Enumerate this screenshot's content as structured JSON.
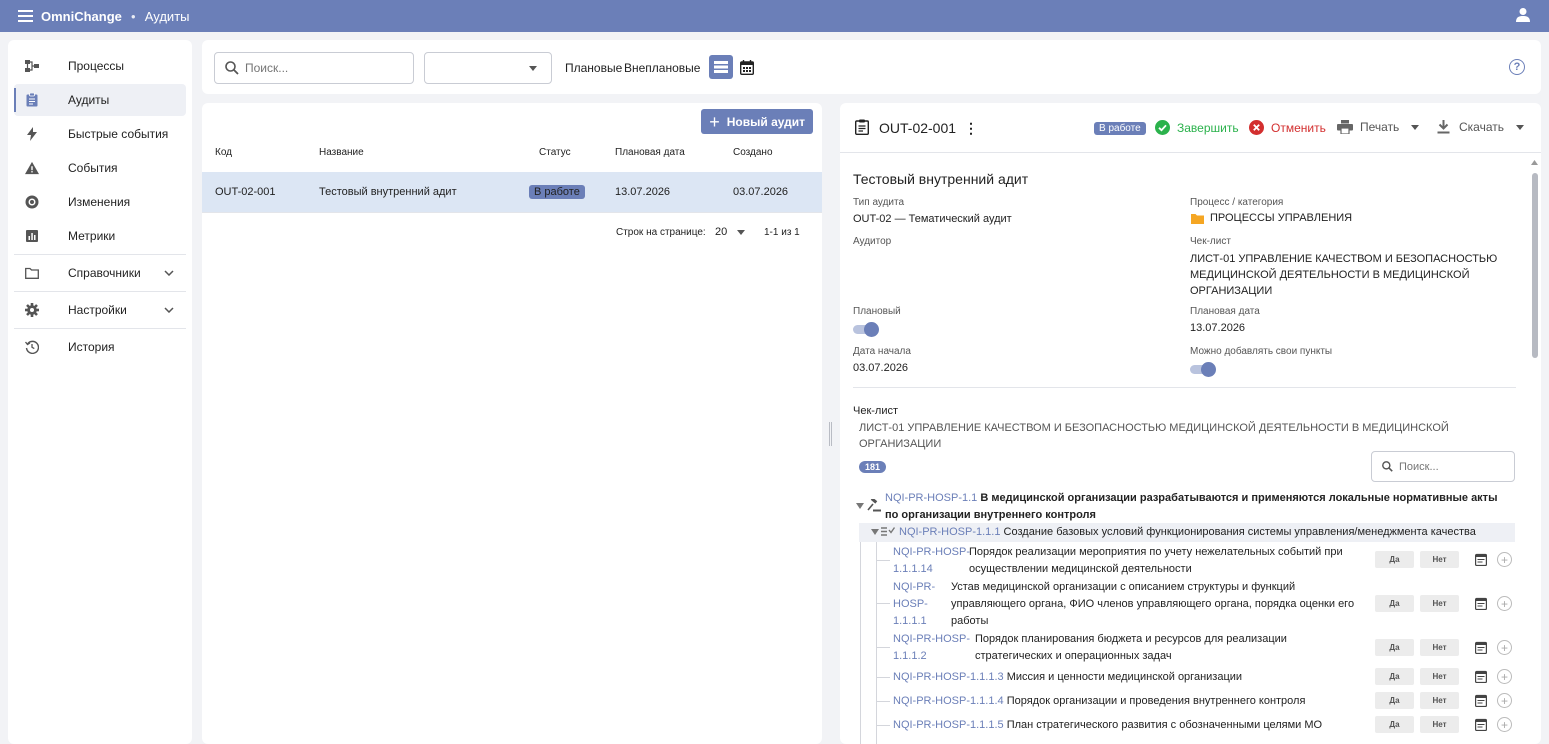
{
  "topbar": {
    "brand": "OmniChange",
    "section": "Аудиты"
  },
  "sidebar": {
    "items": [
      {
        "label": "Процессы",
        "icon": "process-icon"
      },
      {
        "label": "Аудиты",
        "icon": "clipboard-icon",
        "active": true
      },
      {
        "label": "Быстрые события",
        "icon": "lightning-icon"
      },
      {
        "label": "События",
        "icon": "warning-icon"
      },
      {
        "label": "Изменения",
        "icon": "change-icon"
      },
      {
        "label": "Метрики",
        "icon": "metrics-icon"
      },
      {
        "label": "Справочники",
        "icon": "folder-icon",
        "expandable": true
      },
      {
        "label": "Настройки",
        "icon": "gear-icon",
        "expandable": true
      },
      {
        "label": "История",
        "icon": "history-icon"
      }
    ]
  },
  "toolbar": {
    "search_placeholder": "Поиск...",
    "select_value": "",
    "planned_label": "Плановые",
    "unplanned_label": "Внеплановые"
  },
  "list": {
    "new_button": "Новый аудит",
    "columns": [
      "Код",
      "Название",
      "Статус",
      "Плановая дата",
      "Создано"
    ],
    "rows": [
      {
        "code": "OUT-02-001",
        "name": "Тестовый внутренний адит",
        "status": "В работе",
        "planned": "13.07.2026",
        "created": "03.07.2026"
      }
    ],
    "rows_per_page_label": "Строк на странице:",
    "rows_per_page": "20",
    "range": "1-1 из 1"
  },
  "detail": {
    "code": "OUT-02-001",
    "status": "В работе",
    "finish_label": "Завершить",
    "cancel_label": "Отменить",
    "print_label": "Печать",
    "download_label": "Скачать",
    "title": "Тестовый внутренний адит",
    "audit_type_label": "Тип аудита",
    "audit_type": "OUT-02 — Тематический аудит",
    "process_label": "Процесс / категория",
    "process": "ПРОЦЕССЫ УПРАВЛЕНИЯ",
    "auditor_label": "Аудитор",
    "checklist_label": "Чек-лист",
    "checklist_line1": "ЛИСТ-01 УПРАВЛЕНИЕ КАЧЕСТВОМ И БЕЗОПАСНОСТЬЮ",
    "checklist_line2": "МЕДИЦИНСКОЙ ДЕЯТЕЛЬНОСТИ В МЕДИЦИНСКОЙ",
    "checklist_line3": "ОРГАНИЗАЦИИ",
    "planned_label": "Плановый",
    "planned_on": true,
    "planned_date_label": "Плановая дата",
    "planned_date": "13.07.2026",
    "start_date_label": "Дата начала",
    "start_date": "03.07.2026",
    "custom_items_label": "Можно добавлять свои пункты",
    "custom_items_on": true,
    "checklist_section_label": "Чек-лист",
    "checklist_full_line1": "ЛИСТ-01 УПРАВЛЕНИЕ КАЧЕСТВОМ И БЕЗОПАСНОСТЬЮ МЕДИЦИНСКОЙ ДЕЯТЕЛЬНОСТИ В МЕДИЦИНСКОЙ",
    "checklist_full_line2": "ОРГАНИЗАЦИИ",
    "count": "181",
    "checklist_search_placeholder": "Поиск...",
    "yes": "Да",
    "no": "Нет",
    "tree": {
      "root_code": "NQI-PR-HOSP-1.1",
      "root_text_1": "В медицинской организации разрабатываются и применяются локальные нормативные акты",
      "root_text_2": "по организации внутреннего контроля",
      "group_code": "NQI-PR-HOSP-1.1.1",
      "group_text": "Создание базовых условий функционирования системы управления/менеджмента качества",
      "items": [
        {
          "code_1": "NQI-PR-HOSP-",
          "code_2": "1.1.1.14",
          "text_1": "Порядок реализации мероприятия по учету нежелательных событий при",
          "text_2": "осуществлении медицинской деятельности"
        },
        {
          "code_1": "NQI-PR-",
          "code_2": "HOSP-",
          "code_3": "1.1.1.1",
          "text_1": "Устав медицинской организации с описанием структуры и функций",
          "text_2": "управляющего органа, ФИО членов управляющего органа, порядка оценки его",
          "text_3": "работы"
        },
        {
          "code_1": "NQI-PR-HOSP-",
          "code_2": "1.1.1.2",
          "text_1": "Порядок планирования бюджета и ресурсов для реализации",
          "text_2": "стратегических и операционных задач"
        },
        {
          "code": "NQI-PR-HOSP-1.1.1.3",
          "text": "Миссия и ценности медицинской организации"
        },
        {
          "code": "NQI-PR-HOSP-1.1.1.4",
          "text": "Порядок организации и проведения внутреннего контроля"
        },
        {
          "code": "NQI-PR-HOSP-1.1.1.5",
          "text": "План стратегического развития с обозначенными целями МО"
        }
      ]
    }
  },
  "colors": {
    "accent": "#6b7fb8",
    "success": "#2bb24c",
    "danger": "#d32f2f",
    "folder": "#f5a623"
  }
}
